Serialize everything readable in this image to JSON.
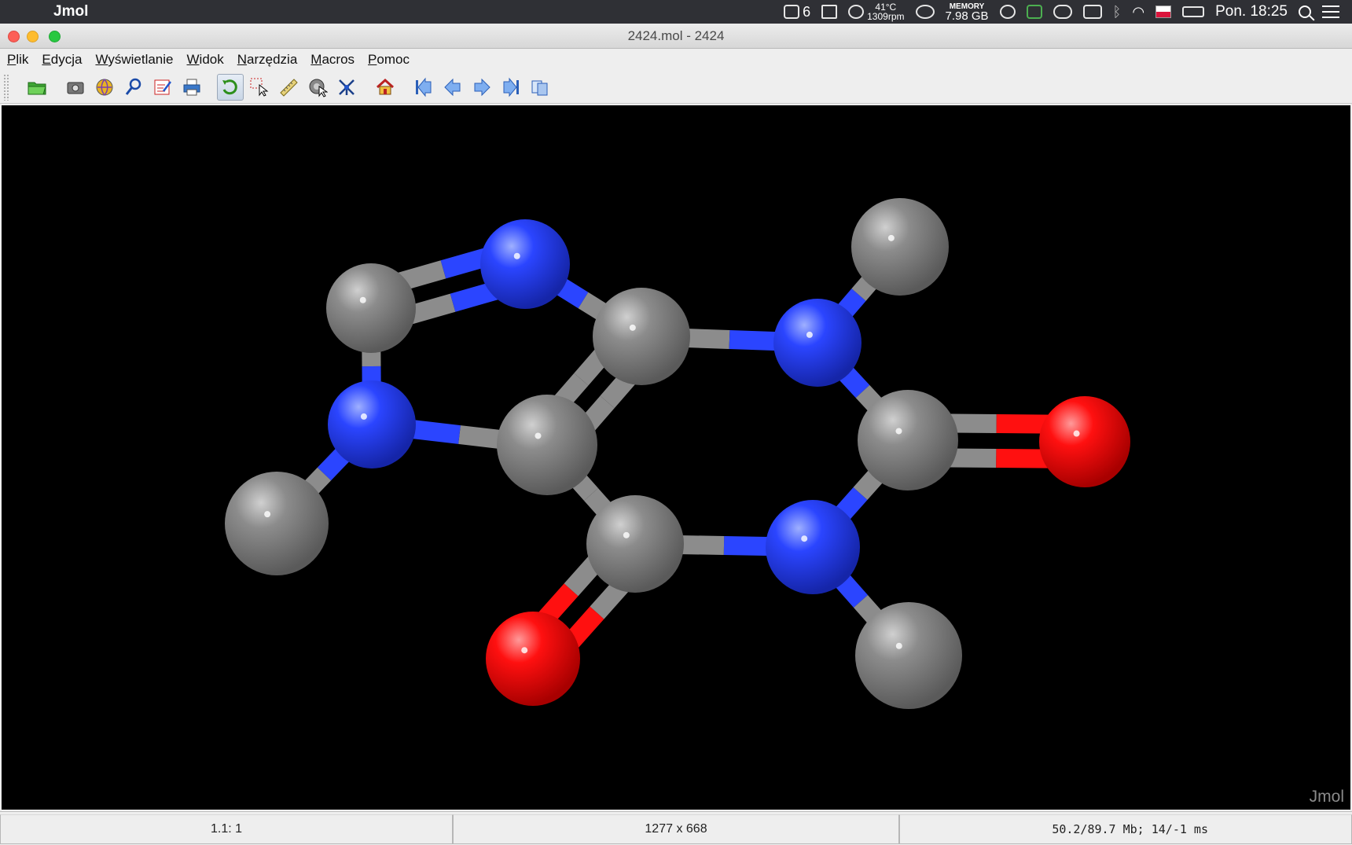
{
  "menubar": {
    "app_name": "Jmol",
    "tray": {
      "notes_count": "6",
      "temp": "41°C",
      "fan": "1309rpm",
      "memory_label": "MEMORY",
      "memory_value": "7.98 GB",
      "clock": "Pon. 18:25"
    }
  },
  "window": {
    "title": "2424.mol - 2424"
  },
  "menu": {
    "items": [
      "Plik",
      "Edycja",
      "Wyświetlanie",
      "Widok",
      "Narzędzia",
      "Macros",
      "Pomoc"
    ]
  },
  "toolbar": {
    "buttons": [
      {
        "icon": "open-folder-icon"
      },
      {
        "icon": "camera-icon"
      },
      {
        "icon": "web-export-icon"
      },
      {
        "icon": "search-script-icon"
      },
      {
        "icon": "edit-script-icon"
      },
      {
        "icon": "print-icon"
      },
      {
        "icon": "rotate-icon",
        "active": true
      },
      {
        "icon": "pick-icon"
      },
      {
        "icon": "ruler-icon"
      },
      {
        "icon": "spin-icon"
      },
      {
        "icon": "atom-modelkit-icon"
      },
      {
        "icon": "home-icon"
      },
      {
        "icon": "first-frame-icon"
      },
      {
        "icon": "previous-frame-icon"
      },
      {
        "icon": "next-frame-icon"
      },
      {
        "icon": "last-frame-icon"
      },
      {
        "icon": "all-frames-icon"
      }
    ]
  },
  "viewer": {
    "watermark": "Jmol",
    "colors": {
      "background": "#000000",
      "carbon": "#8c8c8c",
      "nitrogen": "#2b45ff",
      "oxygen": "#ff1010"
    }
  },
  "status": {
    "frame": "1.1: 1",
    "size": "1277 x 668",
    "memory": "50.2/89.7 Mb;  14/-1 ms"
  }
}
